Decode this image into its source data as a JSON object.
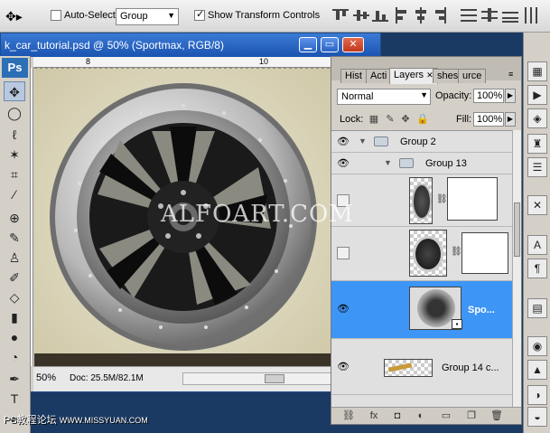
{
  "options_bar": {
    "auto_select_label": "Auto-Select:",
    "auto_select_value": "Group",
    "show_transform_label": "Show Transform Controls",
    "show_transform_checked": true,
    "tool_preset_icon": "move-tool-icon"
  },
  "document": {
    "title": "k_car_tutorial.psd @ 50% (Sportmax, RGB/8)",
    "ruler_marks": [
      "8",
      "10"
    ],
    "status": {
      "zoom": "50%",
      "doc_size": "Doc: 25.5M/82.1M"
    },
    "overlay_text": "ALFOART.COM"
  },
  "tools": {
    "logo": "Ps"
  },
  "layers_panel": {
    "tabs": [
      "Hist",
      "Acti",
      "Layers",
      "shes",
      "urce"
    ],
    "active_tab": "Layers",
    "blend_mode": "Normal",
    "opacity_label": "Opacity:",
    "opacity_value": "100%",
    "lock_label": "Lock:",
    "fill_label": "Fill:",
    "fill_value": "100%",
    "layers": [
      {
        "name": "Group 2",
        "type": "group",
        "visible": true
      },
      {
        "name": "Group 13",
        "type": "group",
        "visible": true
      },
      {
        "name": "",
        "type": "layer-with-mask",
        "visible": false
      },
      {
        "name": "",
        "type": "layer-with-mask",
        "visible": false
      },
      {
        "name": "Spo...",
        "type": "smart-object",
        "visible": true,
        "selected": true
      },
      {
        "name": "Group 14 c...",
        "type": "layer",
        "visible": true
      }
    ]
  },
  "watermark": "PS教程论坛",
  "watermark_site": "WWW.MISSYUAN.COM",
  "colors": {
    "selection": "#3d95f5",
    "title_bar": "#2a63c4",
    "panel_bg": "#d4d0c8"
  }
}
